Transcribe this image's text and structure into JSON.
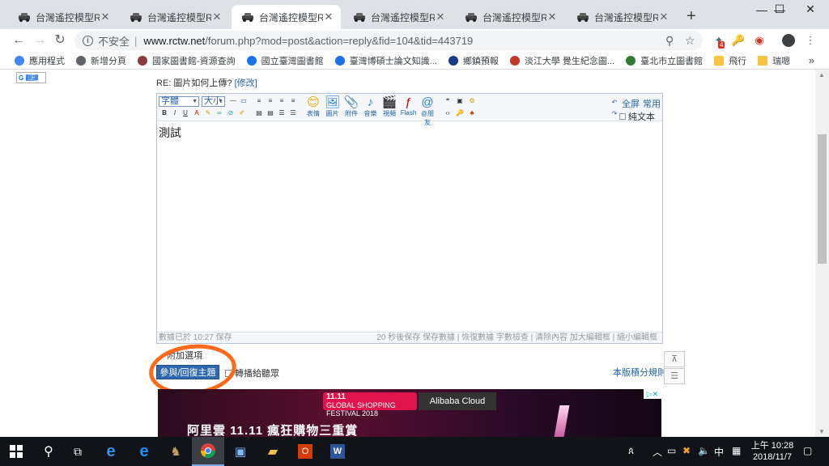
{
  "browser": {
    "tabs": [
      {
        "title": "台灣遙控模型RCTW",
        "active": false
      },
      {
        "title": "台灣遙控模型RCTW",
        "active": false
      },
      {
        "title": "台灣遙控模型RCTW",
        "active": true
      },
      {
        "title": "台灣遙控模型RCTW",
        "active": false
      },
      {
        "title": "台灣遙控模型RCTW",
        "active": false
      },
      {
        "title": "台灣遙控模型RCTW",
        "active": false
      }
    ],
    "new_tab": "+",
    "window": {
      "minimize": "—",
      "maximize": "☐",
      "close": "✕"
    },
    "omnibox": {
      "security": "不安全",
      "url_host": "www.rctw.net",
      "url_rest": "/forum.php?mod=post&action=reply&fid=104&tid=443719"
    },
    "extension_badge": "4",
    "bookmarks": [
      {
        "label": "應用程式",
        "icon": "apps-grid-icon"
      },
      {
        "label": "新增分頁",
        "icon": "page-icon"
      },
      {
        "label": "國家圖書館-資源查詢",
        "icon": "library-seal-icon"
      },
      {
        "label": "國立臺灣圖書館",
        "icon": "library-building-icon"
      },
      {
        "label": "臺灣博碩士論文知識...",
        "icon": "thesis-icon"
      },
      {
        "label": "鄉鎮預報",
        "icon": "eye-icon"
      },
      {
        "label": "淡江大學 覺生紀念圖...",
        "icon": "university-seal-icon"
      },
      {
        "label": "臺北市立圖書館",
        "icon": "city-library-icon"
      },
      {
        "label": "飛行",
        "icon": "folder-icon"
      },
      {
        "label": "瑞嗯",
        "icon": "folder-icon"
      }
    ],
    "bookmarks_more": "»"
  },
  "page": {
    "google_translate": "G 翻譯",
    "reply_title_prefix": "RE: 圖片如何上傳? ",
    "reply_title_link": "[修改]",
    "editor": {
      "font_select": "字體",
      "size_select": "大小",
      "buttons": [
        {
          "label": "表情",
          "icon": "emoji-icon",
          "glyph": "😊"
        },
        {
          "label": "圖片",
          "icon": "image-icon",
          "glyph": "🖼"
        },
        {
          "label": "附件",
          "icon": "paperclip-icon",
          "glyph": "📎"
        },
        {
          "label": "音樂",
          "icon": "music-note-icon",
          "glyph": "♪"
        },
        {
          "label": "視頻",
          "icon": "video-icon",
          "glyph": "🎬"
        },
        {
          "label": "Flash",
          "icon": "flash-icon",
          "glyph": "ƒ"
        },
        {
          "label": "@朋友",
          "icon": "at-icon",
          "glyph": "@"
        }
      ],
      "fullscreen": "全屏",
      "common": "常用",
      "plain_text": "純文本",
      "content": "測試",
      "status_left": "數據已於 10:27 保存",
      "status_right": "20 秒後保存 保存數據 | 恢復數據    字數檢查 | 清除內容    加大編輯框 | 縮小編輯框"
    },
    "extra_options": "附加選項",
    "submit_button": "參與/回復主題",
    "share_label": "轉播給聽眾",
    "rules_link": "本版積分規則",
    "ad": {
      "badge_line1": "11.11",
      "badge_line2": "GLOBAL SHOPPING FESTIVAL 2018",
      "brand": "Alibaba Cloud",
      "headline": "阿里雲 11.11  瘋狂購物三重賞",
      "close": "▷✕"
    }
  },
  "taskbar": {
    "ime": "中",
    "time": "上午 10:28",
    "date": "2018/11/7"
  },
  "colors": {
    "annotation_circle": "#ff6a1a",
    "submit_bg": "#2f68ad",
    "link": "#2366a8"
  }
}
